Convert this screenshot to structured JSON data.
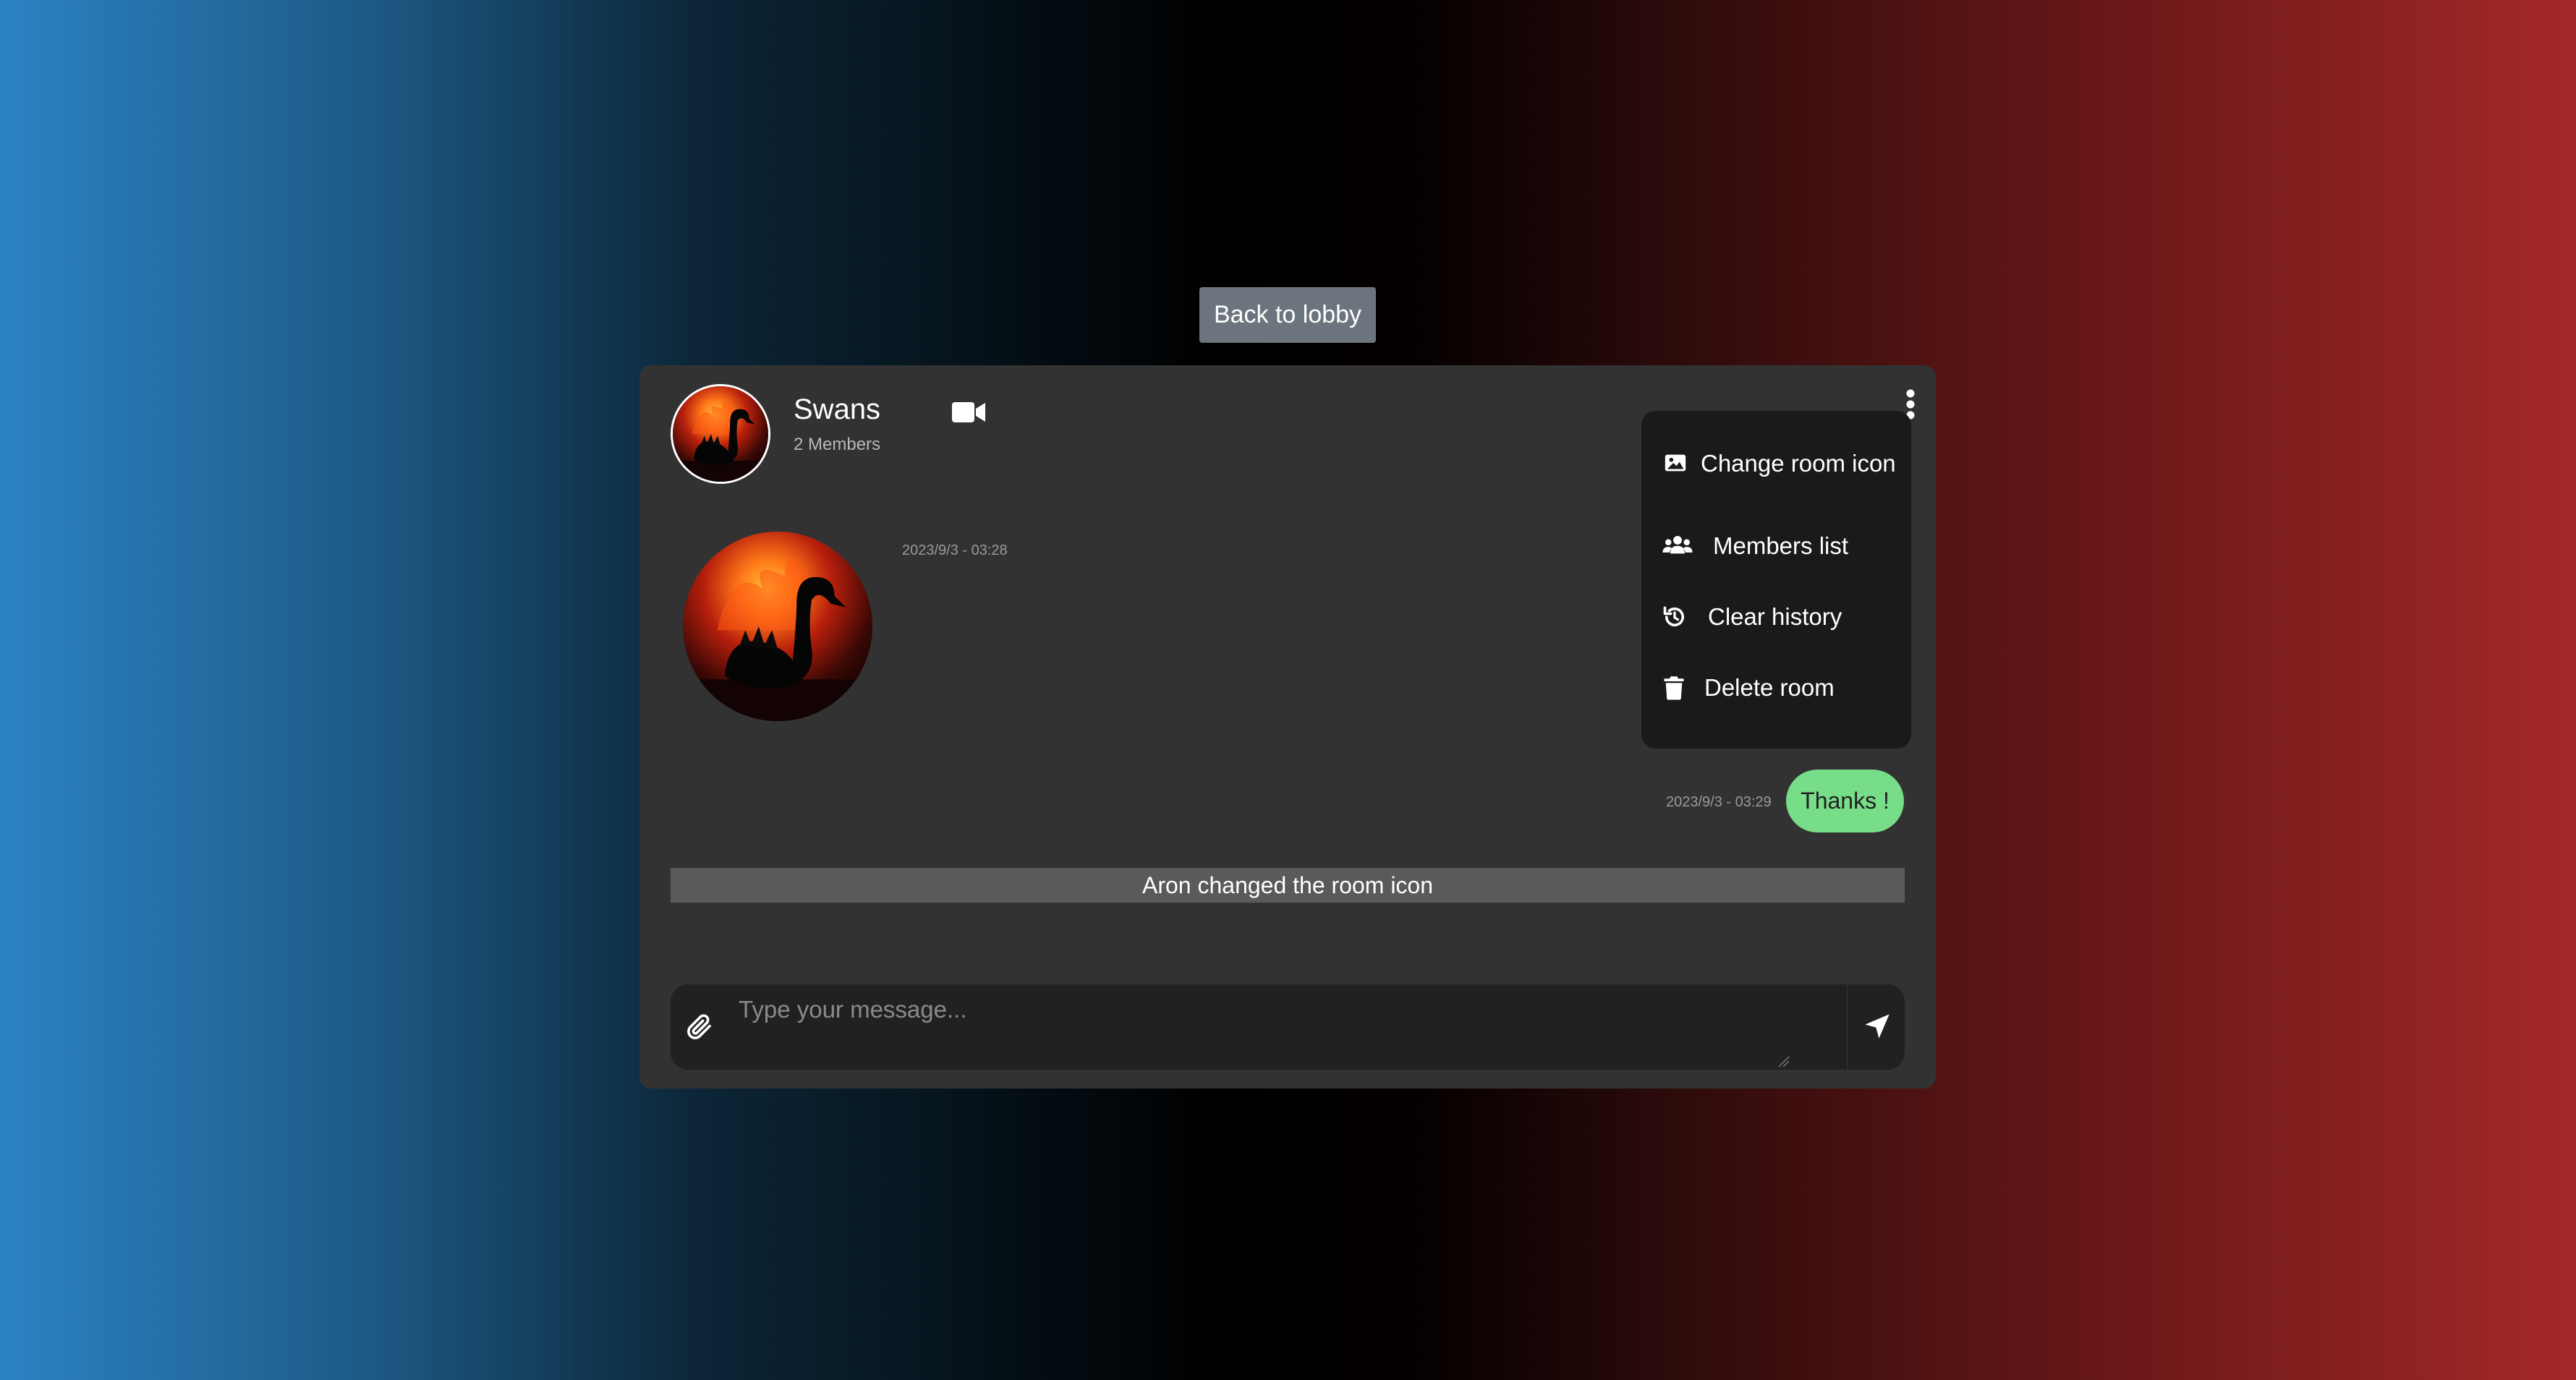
{
  "top": {
    "back_label": "Back to lobby"
  },
  "room": {
    "name": "Swans",
    "members": "2 Members"
  },
  "messages": [
    {
      "timestamp": "2023/9/3 - 03:28",
      "kind": "image"
    },
    {
      "timestamp": "2023/9/3 - 03:29",
      "text": "Thanks !"
    }
  ],
  "system_message": "Aron changed the room icon",
  "composer": {
    "placeholder": "Type your message..."
  },
  "menu": {
    "items": [
      {
        "label": "Change room icon",
        "icon": "image-icon"
      },
      {
        "label": "Members list",
        "icon": "users-icon"
      },
      {
        "label": "Clear history",
        "icon": "history-icon"
      },
      {
        "label": "Delete room",
        "icon": "trash-icon"
      }
    ]
  },
  "colors": {
    "card": "#323232",
    "menu": "#1a1a1a",
    "bubble": "#77dd88",
    "system_bar": "#5a5a5a",
    "composer": "#212121",
    "back_button": "#6c757d"
  }
}
